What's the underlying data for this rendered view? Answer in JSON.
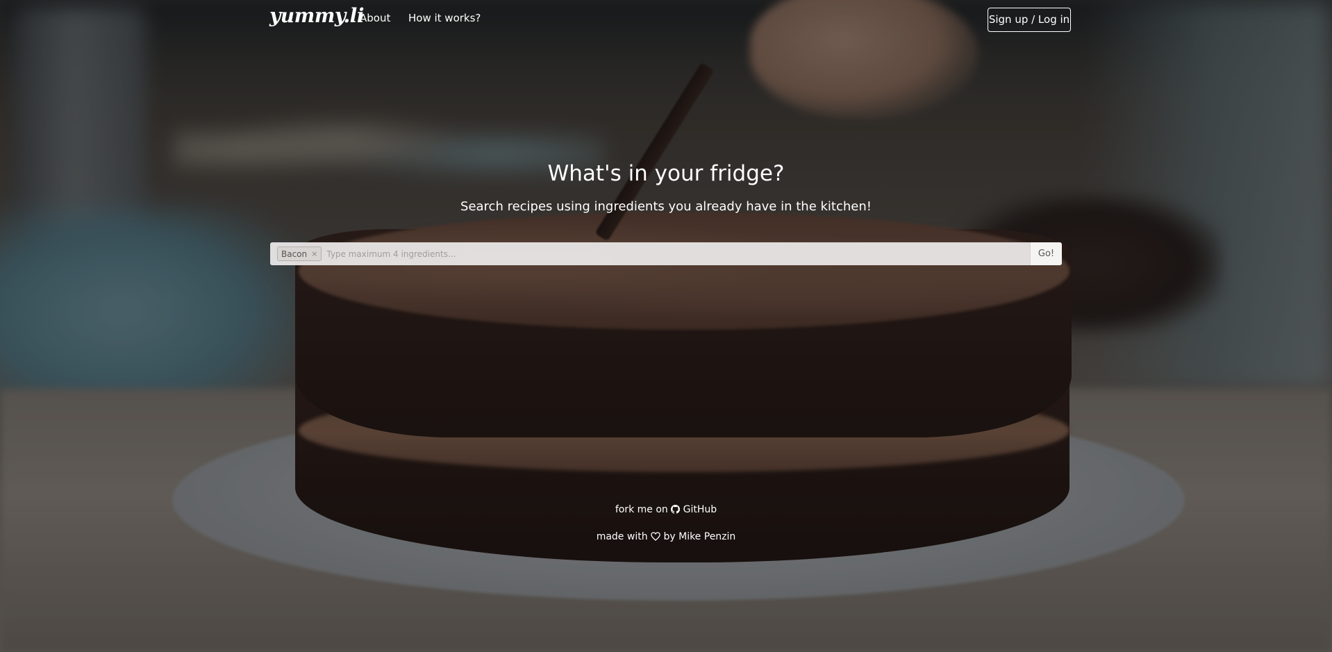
{
  "navbar": {
    "brand": "yummy.li",
    "links": [
      {
        "label": "About"
      },
      {
        "label": "How it works?"
      }
    ],
    "login_label": "Sign up / Log in"
  },
  "hero": {
    "title": "What's in your fridge?",
    "subtitle": "Search recipes using ingredients you already have in the kitchen!"
  },
  "search": {
    "tags": [
      {
        "label": "Bacon",
        "remove_glyph": "×"
      }
    ],
    "placeholder": "Type maximum 4 ingredients...",
    "value": "",
    "go_label": "Go!"
  },
  "footer": {
    "fork_prefix": "fork me on",
    "fork_icon": "github-icon",
    "fork_link": "GitHub",
    "made_prefix": "made with",
    "made_icon": "heart-icon",
    "made_suffix": "by",
    "author": "Mike Penzin"
  },
  "colors": {
    "text": "#ffffff",
    "search_background": "#eeeceb",
    "tag_background": "#d7d4d1"
  }
}
